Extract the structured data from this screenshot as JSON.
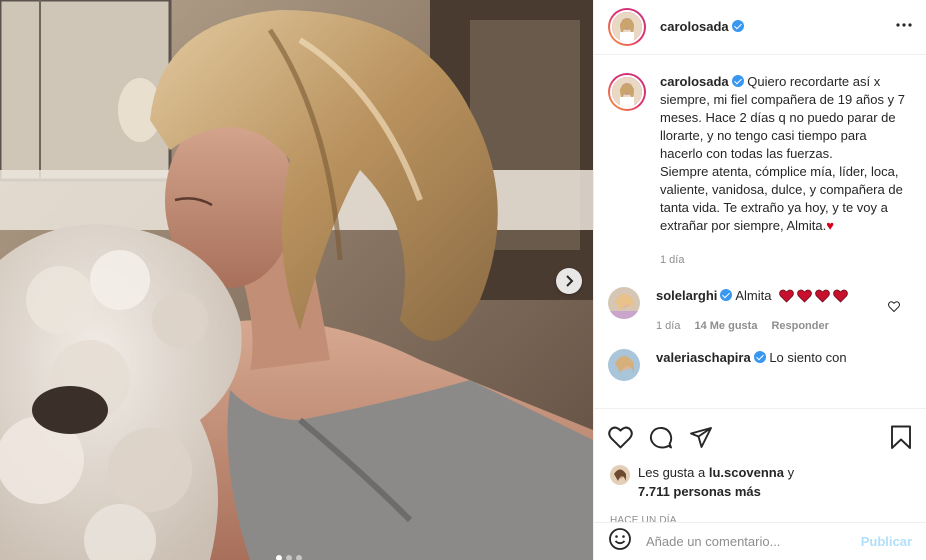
{
  "post": {
    "author": {
      "username": "carolosada",
      "verified": true,
      "more_icon": "more-horizontal-icon"
    },
    "photo": {
      "description_icon": "photo",
      "next_icon": "chevron-right-icon",
      "carousel_count": 3,
      "carousel_active": 0
    },
    "caption": {
      "username": "carolosada",
      "text": "Quiero recordarte así x siempre, mi fiel compañera de 19 años y 7 meses. Hace 2 días q no puedo parar de llorarte, y no tengo casi tiempo para hacerlo con todas las fuerzas.\nSiempre atenta, cómplice mía, líder, loca, valiente, vanidosa, dulce, y compañera de tanta vida. Te extraño ya hoy, y te voy a extrañar por siempre, Almita.",
      "emoji": "♥",
      "time": "1 día"
    },
    "comments": [
      {
        "username": "solelarghi",
        "verified": true,
        "text": "Almita",
        "hearts": 4,
        "time": "1 día",
        "likes": "14 Me gusta",
        "reply_label": "Responder"
      },
      {
        "username": "valeriaschapira",
        "verified": true,
        "text": "Lo siento con"
      }
    ],
    "actions": {
      "like_icon": "heart-outline-icon",
      "comment_icon": "comment-icon",
      "share_icon": "paper-plane-icon",
      "save_icon": "bookmark-icon"
    },
    "likes": {
      "prefix": "Les gusta a ",
      "user": "lu.scovenna",
      "joiner": " y",
      "count": "7.711 personas más"
    },
    "timestamp": "HACE UN DÍA",
    "composer": {
      "emoji_icon": "smiley-icon",
      "placeholder": "Añade un comentario...",
      "publish_label": "Publicar"
    }
  },
  "colors": {
    "accent": "#3897f0",
    "publish_disabled": "#b2dffc",
    "heart": "#d9001b",
    "muted": "#8e8e8e",
    "text": "#262626"
  }
}
